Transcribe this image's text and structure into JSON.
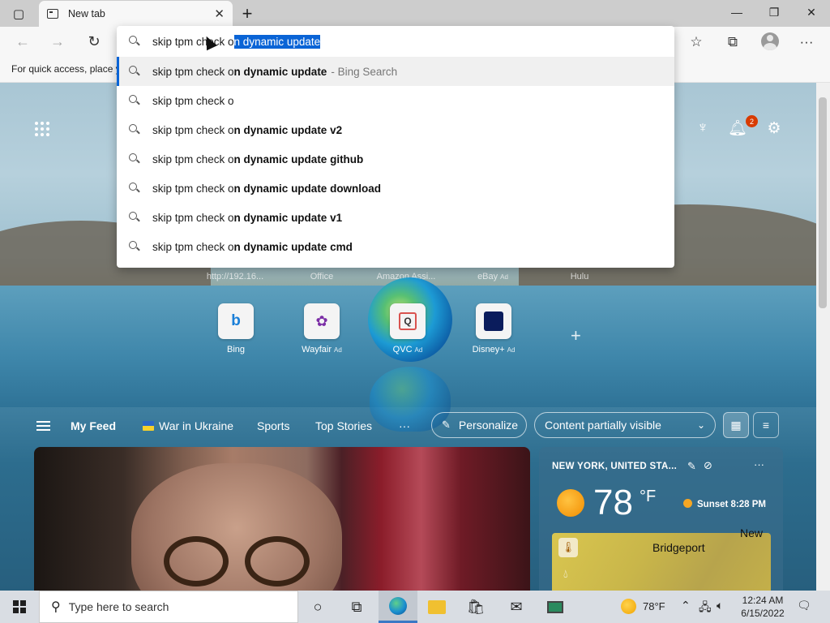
{
  "browser": {
    "tab_title": "New tab",
    "favorites_hint": "For quick access, place y"
  },
  "omnibox": {
    "typed": "skip tpm check o",
    "autocomplete": "n dynamic update",
    "suggestions": [
      {
        "prefix": "skip tpm check o",
        "bold": "n dynamic update",
        "suffix": "- Bing Search"
      },
      {
        "prefix": "skip tpm check o",
        "bold": "",
        "suffix": ""
      },
      {
        "prefix": "skip tpm check o",
        "bold": "n dynamic update v2",
        "suffix": ""
      },
      {
        "prefix": "skip tpm check o",
        "bold": "n dynamic update github",
        "suffix": ""
      },
      {
        "prefix": "skip tpm check o",
        "bold": "n dynamic update download",
        "suffix": ""
      },
      {
        "prefix": "skip tpm check o",
        "bold": "n dynamic update v1",
        "suffix": ""
      },
      {
        "prefix": "skip tpm check o",
        "bold": "n dynamic update cmd",
        "suffix": ""
      }
    ]
  },
  "header": {
    "notification_count": "2"
  },
  "quick_links_top": [
    "http://192.16...",
    "Office",
    "Amazon Assi...",
    "eBay",
    "Hulu"
  ],
  "quick_links_top_ad": "Ad",
  "quick_links": [
    {
      "label": "Bing",
      "ad": ""
    },
    {
      "label": "Wayfair",
      "ad": "Ad"
    },
    {
      "label": "QVC",
      "ad": "Ad"
    },
    {
      "label": "Disney+",
      "ad": "Ad"
    }
  ],
  "feed": {
    "my_feed": "My Feed",
    "war": "War in Ukraine",
    "sports": "Sports",
    "top_stories": "Top Stories",
    "more": "···",
    "personalize": "Personalize",
    "content_visibility": "Content partially visible"
  },
  "weather": {
    "location": "NEW YORK, UNITED STA...",
    "temp": "78",
    "unit": "°F",
    "sunset": "Sunset 8:28 PM",
    "map_city": "Bridgeport",
    "map_new": "New"
  },
  "taskbar": {
    "search_placeholder": "Type here to search",
    "temp": "78°F",
    "time": "12:24 AM",
    "date": "6/15/2022"
  }
}
